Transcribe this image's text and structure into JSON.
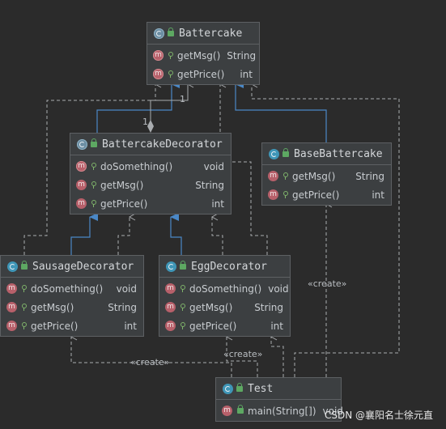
{
  "classes": {
    "battercake": {
      "name": "Battercake",
      "methods": [
        {
          "name": "getMsg()",
          "type": "String"
        },
        {
          "name": "getPrice()",
          "type": "int"
        }
      ]
    },
    "decorator": {
      "name": "BattercakeDecorator",
      "methods": [
        {
          "name": "doSomething()",
          "type": "void"
        },
        {
          "name": "getMsg()",
          "type": "String"
        },
        {
          "name": "getPrice()",
          "type": "int"
        }
      ]
    },
    "base": {
      "name": "BaseBattercake",
      "methods": [
        {
          "name": "getMsg()",
          "type": "String"
        },
        {
          "name": "getPrice()",
          "type": "int"
        }
      ]
    },
    "sausage": {
      "name": "SausageDecorator",
      "methods": [
        {
          "name": "doSomething()",
          "type": "void"
        },
        {
          "name": "getMsg()",
          "type": "String"
        },
        {
          "name": "getPrice()",
          "type": "int"
        }
      ]
    },
    "egg": {
      "name": "EggDecorator",
      "methods": [
        {
          "name": "doSomething()",
          "type": "void"
        },
        {
          "name": "getMsg()",
          "type": "String"
        },
        {
          "name": "getPrice()",
          "type": "int"
        }
      ]
    },
    "test": {
      "name": "Test",
      "methods": [
        {
          "name": "main(String[])",
          "type": "void"
        }
      ]
    }
  },
  "labels": {
    "mult_one_top": "1",
    "mult_one_bottom": "1",
    "create_base": "«create»",
    "create_sausage": "«create»",
    "create_egg": "«create»"
  },
  "watermark": "CSDN @襄阳名士徐元直",
  "colors": {
    "background": "#2b2b2b",
    "box": "#3c3f41",
    "inherit_arrow": "#4a88c7",
    "dashed_line": "#a9acaf"
  },
  "icons": {
    "abstract_class": "abstract-class-icon",
    "class": "class-icon",
    "method": "method-icon",
    "abstract_method": "abstract-method-icon"
  }
}
